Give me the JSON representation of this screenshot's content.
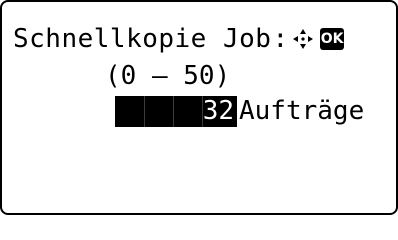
{
  "screen": {
    "title": "Schnellkopie Job",
    "title_colon": ":",
    "nav_icon": "four-way-arrow-icon",
    "ok_label": "OK",
    "range": "(0 – 50)",
    "value": "32",
    "unit": "Aufträge"
  }
}
